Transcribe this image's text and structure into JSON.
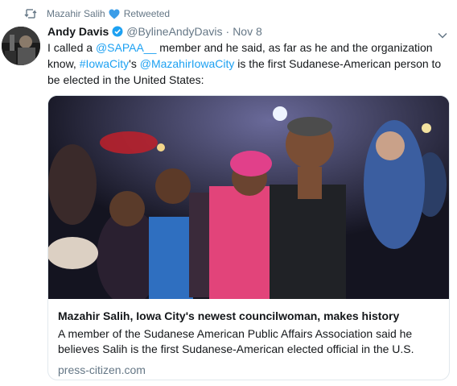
{
  "retweet": {
    "retweeter": "Mazahir Salih",
    "label": "Retweeted",
    "heart_color": "#3b9de8"
  },
  "tweet": {
    "fullname": "Andy Davis",
    "handle": "@BylineAndyDavis",
    "separator": "·",
    "time": "Nov 8",
    "text_parts": {
      "p1": "I called a ",
      "mention1": "@SAPAA__",
      "p2": " member and he said, as far as he and the organization know, ",
      "hashtag": "#IowaCity",
      "p3": "'s ",
      "mention2": "@MazahirIowaCity",
      "p4": " is the first Sudanese-American person to be elected in the United States:"
    }
  },
  "card": {
    "title": "Mazahir Salih, Iowa City's newest councilwoman, makes history",
    "description": "A member of the Sudanese American Public Affairs Association said he believes Salih is the first Sudanese-American elected official in the U.S.",
    "domain": "press-citizen.com"
  },
  "colors": {
    "link": "#1da1f2",
    "verified": "#1da1f2",
    "secondary_text": "#657786"
  },
  "icons": {
    "retweet": "retweet-icon",
    "heart": "heart-icon",
    "verified": "verified-badge-icon",
    "caret": "chevron-down-icon"
  }
}
